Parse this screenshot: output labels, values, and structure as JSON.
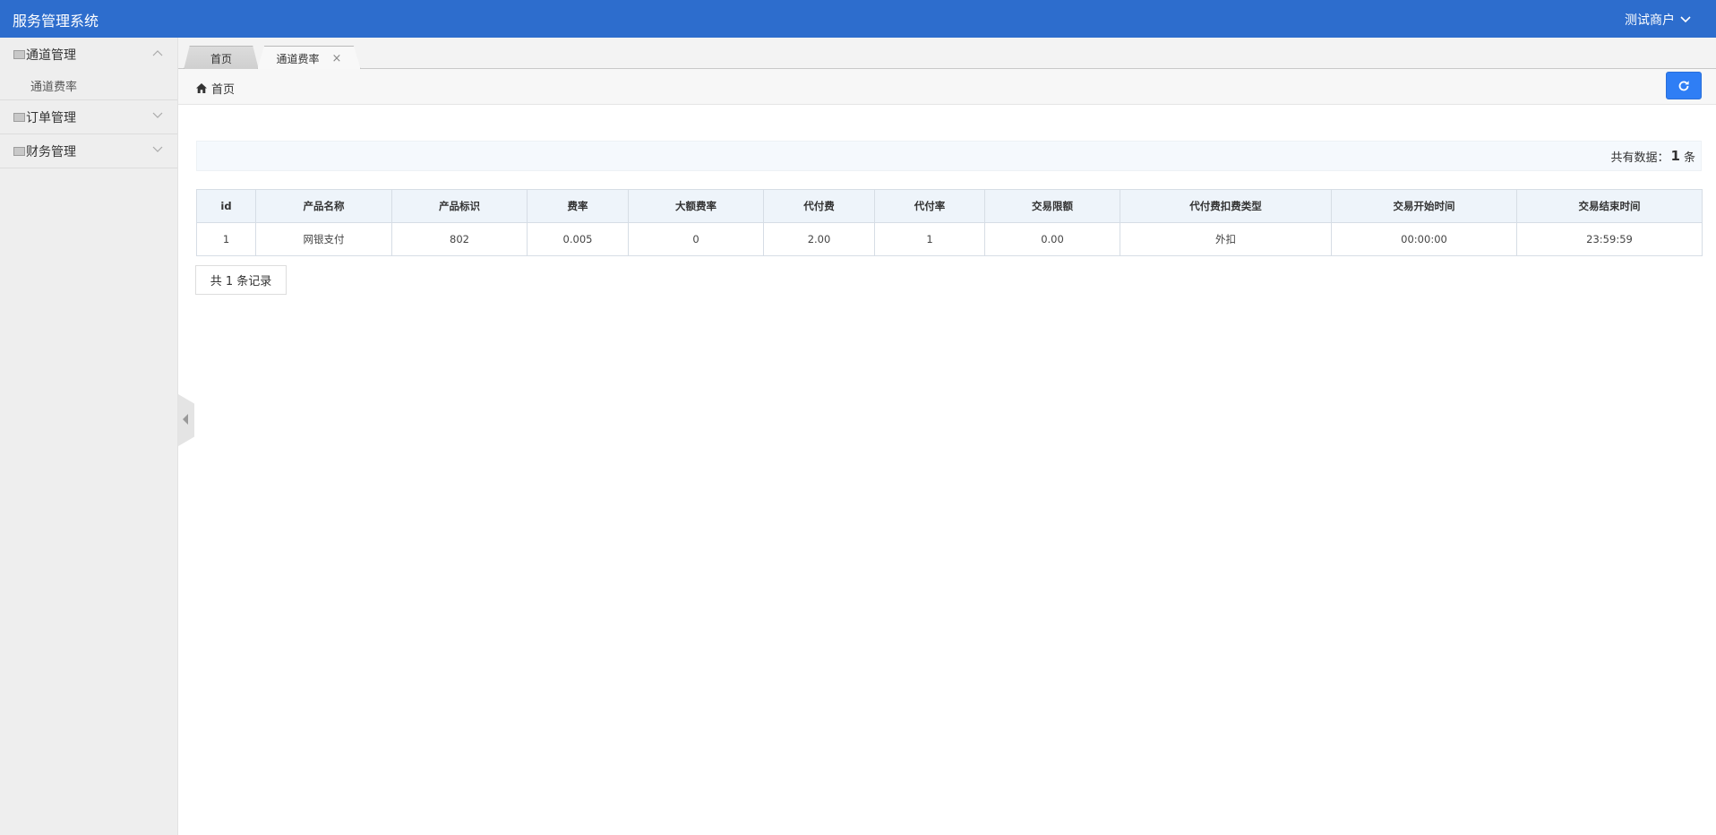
{
  "header": {
    "app_title": "服务管理系统",
    "user_label": "测试商户"
  },
  "sidebar": {
    "groups": [
      {
        "label": "通道管理",
        "expanded": true,
        "items": [
          {
            "label": "通道费率"
          }
        ]
      },
      {
        "label": "订单管理",
        "expanded": false,
        "items": []
      },
      {
        "label": "财务管理",
        "expanded": false,
        "items": []
      }
    ]
  },
  "tabs": [
    {
      "label": "首页"
    },
    {
      "label": "通道费率",
      "close": "×"
    }
  ],
  "breadcrumb": {
    "label": "首页"
  },
  "summary": {
    "prefix": "共有数据：",
    "count": "1",
    "suffix": "条"
  },
  "table": {
    "headers": [
      "id",
      "产品名称",
      "产品标识",
      "费率",
      "大额费率",
      "代付费",
      "代付率",
      "交易限额",
      "代付费扣费类型",
      "交易开始时间",
      "交易结束时间"
    ],
    "rows": [
      [
        "1",
        "网银支付",
        "802",
        "0.005",
        "0",
        "2.00",
        "1",
        "0.00",
        "外扣",
        "00:00:00",
        "23:59:59"
      ]
    ]
  },
  "pager": {
    "label": "共 1 条记录"
  },
  "colors": {
    "header_bg": "#2d6dcd",
    "accent_button": "#2f7ef5",
    "sidebar_bg": "#eeeeee"
  }
}
